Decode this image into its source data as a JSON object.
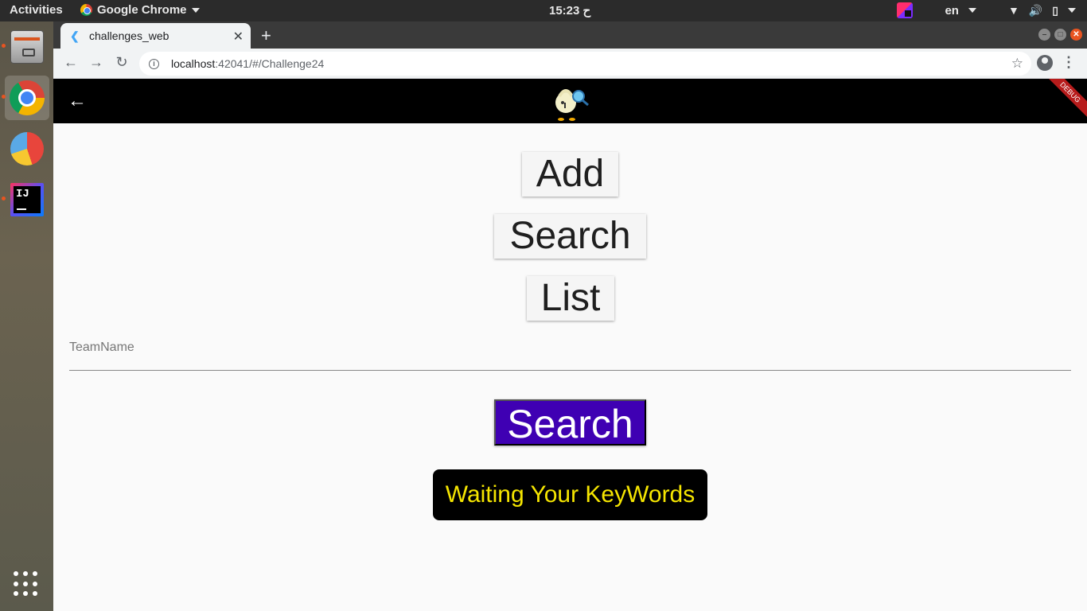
{
  "topbar": {
    "activities": "Activities",
    "app_name": "Google Chrome",
    "clock": "15:23 ح",
    "language": "en"
  },
  "browser": {
    "tab_title": "challenges_web",
    "url_host": "localhost",
    "url_path": ":42041/#/Challenge24"
  },
  "app": {
    "debug_banner": "DEBUG",
    "buttons": {
      "add": "Add",
      "search": "Search",
      "list": "List"
    },
    "team_field_label": "TeamName",
    "search_button": "Search",
    "status_text": "Waiting Your KeyWords"
  },
  "colors": {
    "primary_button": "#3f00b3",
    "status_bg": "#000000",
    "status_text": "#f5e500",
    "appbar_bg": "#000000"
  }
}
